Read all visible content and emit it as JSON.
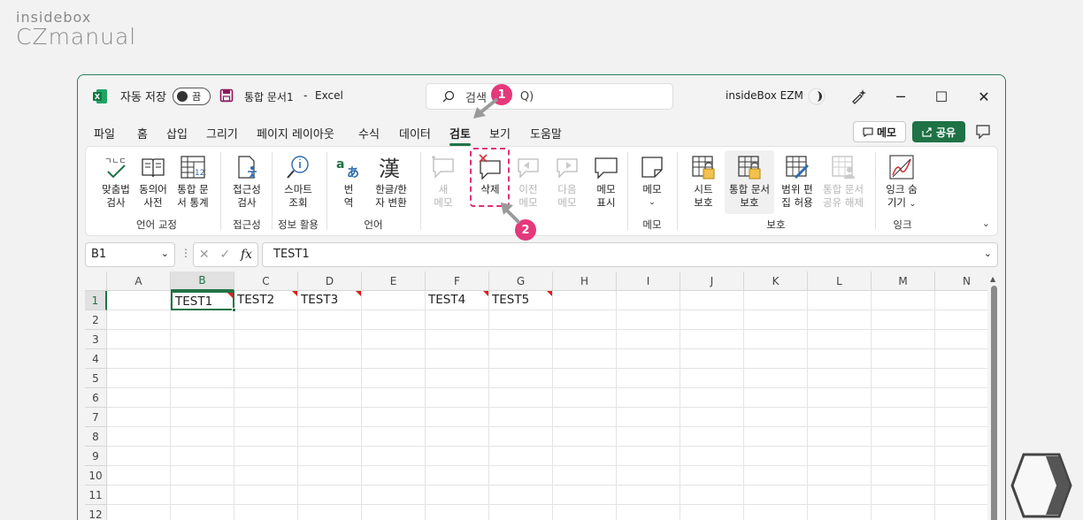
{
  "brand": {
    "line1": "insidebox",
    "line2": "CZmanual"
  },
  "titlebar": {
    "autosave_label": "자동 저장",
    "toggle_state": "끔",
    "doc_name": "통합 문서1",
    "separator": "-",
    "app_name": "Excel",
    "search_placeholder": "검색 (Alt+Q)",
    "search_visible_text": "검색",
    "search_visible_tail": "Q)",
    "user": "insideBox EZM",
    "minimize": "─",
    "maximize": "☐",
    "close": "✕"
  },
  "tabs": [
    "파일",
    "홈",
    "삽입",
    "그리기",
    "페이지 레이아웃",
    "수식",
    "데이터",
    "검토",
    "보기",
    "도움말"
  ],
  "active_tab": "검토",
  "header_buttons": {
    "memo": "메모",
    "share": "공유"
  },
  "ribbon": {
    "spelling": "맞춤법\n검사",
    "thesaurus": "동의어\n사전",
    "workbook_stats": "통합 문\n서 통계",
    "group_proofing": "언어 교정",
    "accessibility": "접근성\n검사",
    "group_accessibility": "접근성",
    "smart_lookup": "스마트\n조회",
    "group_insights": "정보 활용",
    "translate": "번\n역",
    "hangul_hanja": "한글/한\n자 변환",
    "group_language": "언어",
    "new_comment": "새\n메모",
    "delete": "삭제",
    "previous_comment": "이전\n메모",
    "next_comment": "다음\n메모",
    "show_comments": "메모\n표시",
    "notes": "메모",
    "group_notes": "메모",
    "protect_sheet": "시트\n보호",
    "protect_workbook": "통합 문서\n보호",
    "allow_edit_ranges": "범위 편\n집 허용",
    "unshare_workbook": "통합 문서\n공유 해제",
    "group_protect": "보호",
    "hide_ink": "잉크 숨\n기기",
    "group_ink": "잉크"
  },
  "annotations": {
    "badge1": "1",
    "badge2": "2"
  },
  "formula_bar": {
    "name_box": "B1",
    "fx": "fx",
    "value": "TEST1"
  },
  "grid": {
    "columns": [
      "A",
      "B",
      "C",
      "D",
      "E",
      "F",
      "G",
      "H",
      "I",
      "J",
      "K",
      "L",
      "M",
      "N"
    ],
    "rows": [
      "1",
      "2",
      "3",
      "4",
      "5",
      "6",
      "7",
      "8",
      "9",
      "10",
      "11",
      "12"
    ],
    "row1_cells": [
      "",
      "TEST1",
      "TEST2",
      "TEST3",
      "",
      "TEST4",
      "TEST5",
      "",
      "",
      "",
      "",
      "",
      "",
      ""
    ],
    "selected_cell": "B1",
    "comment_indicator_color": "#e01b1b"
  },
  "colors": {
    "excel_green": "#217346",
    "highlight_pink": "#e0307a"
  }
}
